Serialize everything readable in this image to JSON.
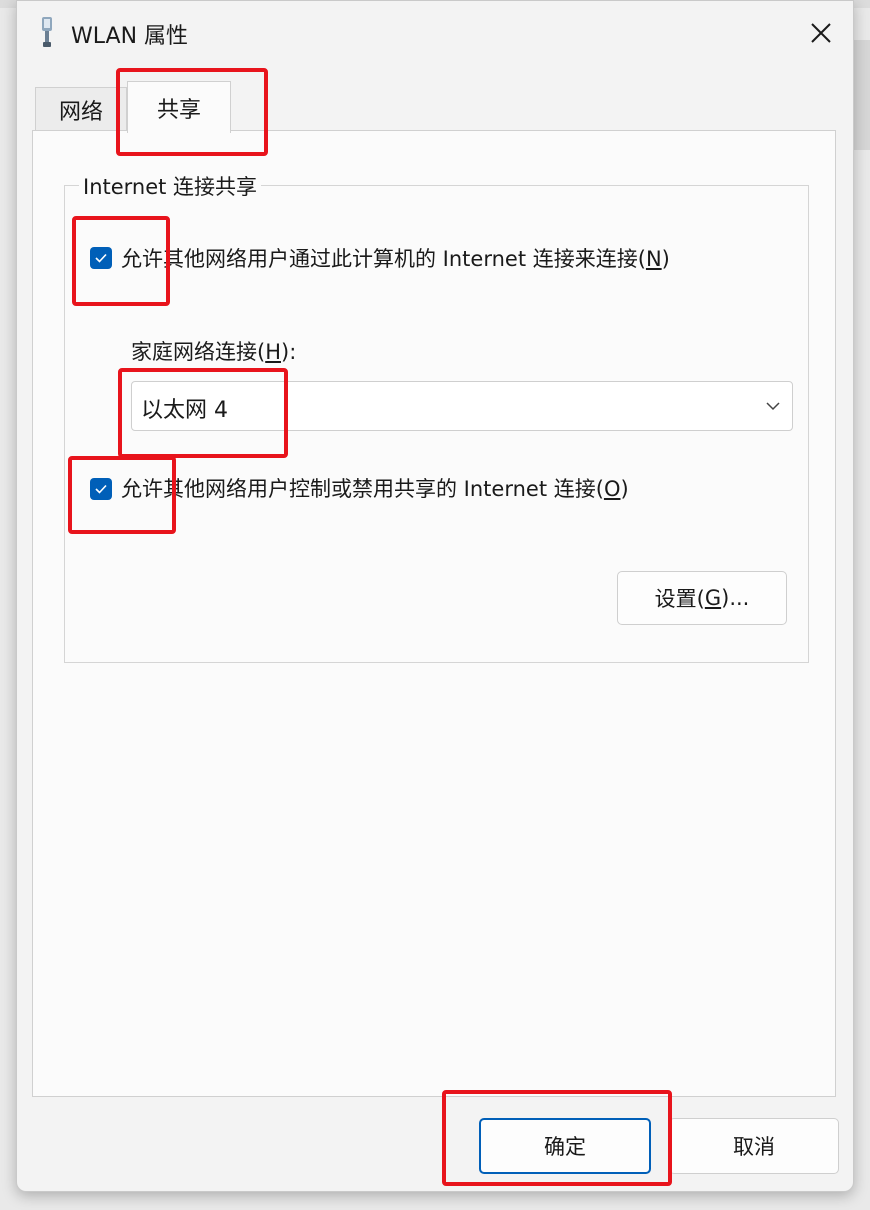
{
  "window": {
    "title": "WLAN 属性",
    "icon": "network-adapter-icon"
  },
  "tabs": [
    {
      "label": "网络",
      "selected": false
    },
    {
      "label": "共享",
      "selected": true
    }
  ],
  "sharing": {
    "group_title": "Internet 连接共享",
    "allow_connect": {
      "checked": true,
      "label_prefix": "允许其他网络用户通过此计算机的 Internet 连接来连接(",
      "label_key": "N",
      "label_suffix": ")"
    },
    "home_network": {
      "label_prefix": "家庭网络连接(",
      "label_key": "H",
      "label_suffix": "):",
      "selected_value": "以太网 4"
    },
    "allow_control": {
      "checked": true,
      "label_prefix": "允许其他网络用户控制或禁用共享的 Internet 连接(",
      "label_key": "O",
      "label_suffix": ")"
    },
    "settings_button": {
      "label_prefix": "设置(",
      "label_key": "G",
      "label_suffix": ")..."
    }
  },
  "footer": {
    "ok_label": "确定",
    "cancel_label": "取消"
  },
  "colors": {
    "accent": "#005fb8",
    "highlight": "#e8141c"
  }
}
